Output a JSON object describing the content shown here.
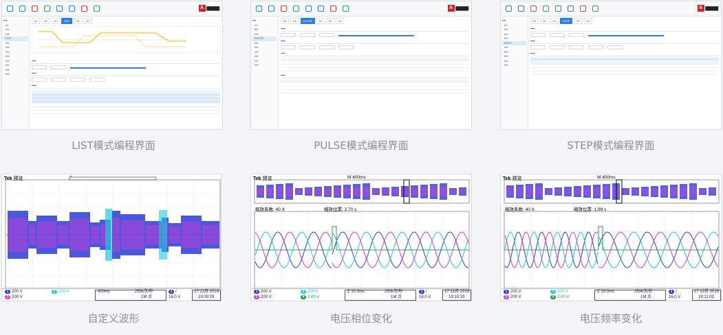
{
  "captions": {
    "list": "LIST模式编程界面",
    "pulse": "PULSE模式编程界面",
    "step": "STEP模式编程界面",
    "custom": "自定义波形",
    "phase": "电压相位变化",
    "freq": "电压频率变化"
  },
  "software": {
    "list": {
      "active_tab": "LIST",
      "sidebar_active": "LIST"
    },
    "pulse": {
      "active_tab": "PULSE",
      "sidebar_active": "PULSE"
    },
    "step": {
      "active_tab": "STEP",
      "sidebar_active": "STEP"
    }
  },
  "scopes": {
    "custom": {
      "brand": "Tek",
      "mode": "预览",
      "footer": {
        "ch1": "200 V",
        "ch2": "200 V",
        "ch3": "200 V",
        "timebase": "400ms",
        "rate": "250k次/秒",
        "points": "1M 点",
        "trig": "16.0 V",
        "date": "17 12月 2019",
        "time": "19:09:29"
      }
    },
    "phase": {
      "brand": "Tek",
      "mode": "预览",
      "overview_time": "M 400ms",
      "zoom_factor": "缩放系数: 40 X",
      "zoom_position": "缩放位置: 2.70 s",
      "footer": {
        "ch1": "200 V",
        "ch2": "200 V",
        "ch3": "200 V",
        "ch4": "2.00 V",
        "timebase": "Z 10.0ms",
        "rate": "250k次/秒",
        "points": "1M 点",
        "trig": "16.0 V",
        "date": "17 12月 2019",
        "time": "19:10:33"
      }
    },
    "freq": {
      "brand": "Tek",
      "mode": "预览",
      "overview_time": "M 400ms",
      "zoom_factor": "缩放系数: 40 X",
      "zoom_position": "缩放位置: 1.99 s",
      "footer": {
        "ch1": "200 V",
        "ch2": "200 V",
        "ch3": "200 V",
        "ch4": "2.00 V",
        "timebase": "Z 10.0ms",
        "rate": "250k次/秒",
        "points": "1M 点",
        "trig": "16.0 V",
        "date": "17 12月 2019",
        "time": "19:11:03"
      }
    }
  },
  "colors": {
    "ch1": "#2a3bd6",
    "ch2": "#20c9d8",
    "ch3": "#d63ad4",
    "ch4": "#20a33a",
    "accent": "#2f7de1",
    "caption": "#8a8f98"
  }
}
